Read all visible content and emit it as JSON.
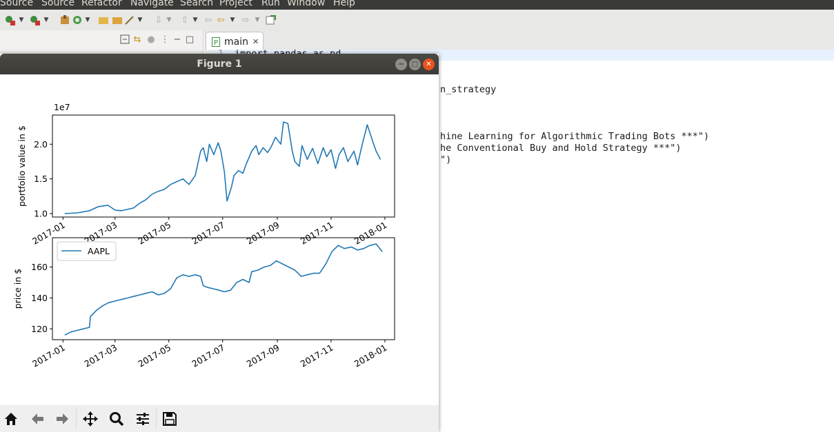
{
  "menubar": {
    "items": [
      "Source",
      "Source",
      "Refactor",
      "Navigate",
      "Search",
      "Project",
      "Run",
      "Window",
      "Help"
    ]
  },
  "editor": {
    "tab_label": "main",
    "tab_close": "✕",
    "line_number": "1",
    "code_lines": [
      "import pandas as pd",
      "n_strategy",
      "hine Learning for Algorithmic Trading Bots ***\")",
      "he Conventional Buy and Hold Strategy ***\")",
      "\")"
    ],
    "code_strings": [
      "hine Learning for Algorithmic Trading Bots ***",
      "he Conventional Buy and Hold Strategy ***"
    ]
  },
  "figure_window": {
    "title": "Figure 1",
    "controls": [
      "minimize",
      "maximize",
      "close"
    ],
    "toolbar_icons": [
      "home-icon",
      "back-arrow-icon",
      "forward-arrow-icon",
      "pan-icon",
      "zoom-icon",
      "subplots-icon",
      "save-icon"
    ]
  },
  "colors": {
    "line": "#1f77b4",
    "menubar_bg": "#3a3a38",
    "titlebar_bg": "#3c3b37",
    "close_button": "#e9541f",
    "string_green": "#2aa12a"
  },
  "chart_data": [
    {
      "type": "line",
      "ylabel": "portfolio value in $",
      "offset_text": "1e7",
      "yticks": [
        "1.0",
        "1.5",
        "2.0"
      ],
      "ytick_values": [
        1.0,
        1.5,
        2.0
      ],
      "xticks": [
        "2017-01",
        "2017-03",
        "2017-05",
        "2017-07",
        "2017-09",
        "2017-11",
        "2018-01"
      ],
      "ylim": [
        0.95,
        2.42
      ],
      "grid": false,
      "x": [
        "2017-01-03",
        "2017-01-17",
        "2017-01-31",
        "2017-02-10",
        "2017-02-21",
        "2017-03-01",
        "2017-03-08",
        "2017-03-15",
        "2017-03-22",
        "2017-03-29",
        "2017-04-05",
        "2017-04-12",
        "2017-04-19",
        "2017-04-26",
        "2017-05-03",
        "2017-05-10",
        "2017-05-17",
        "2017-05-24",
        "2017-05-31",
        "2017-06-06",
        "2017-06-09",
        "2017-06-13",
        "2017-06-16",
        "2017-06-21",
        "2017-06-26",
        "2017-06-29",
        "2017-07-03",
        "2017-07-06",
        "2017-07-11",
        "2017-07-14",
        "2017-07-19",
        "2017-07-24",
        "2017-07-28",
        "2017-08-03",
        "2017-08-08",
        "2017-08-11",
        "2017-08-16",
        "2017-08-21",
        "2017-08-25",
        "2017-08-30",
        "2017-09-05",
        "2017-09-08",
        "2017-09-13",
        "2017-09-18",
        "2017-09-21",
        "2017-09-26",
        "2017-09-29",
        "2017-10-05",
        "2017-10-11",
        "2017-10-17",
        "2017-10-23",
        "2017-10-27",
        "2017-11-01",
        "2017-11-06",
        "2017-11-10",
        "2017-11-15",
        "2017-11-20",
        "2017-11-27",
        "2017-12-01",
        "2017-12-06",
        "2017-12-12",
        "2017-12-18",
        "2017-12-22",
        "2017-12-27"
      ],
      "series": [
        {
          "values": [
            1.0,
            1.01,
            1.04,
            1.1,
            1.12,
            1.05,
            1.04,
            1.06,
            1.08,
            1.15,
            1.2,
            1.28,
            1.32,
            1.35,
            1.42,
            1.46,
            1.5,
            1.42,
            1.55,
            1.9,
            1.95,
            1.75,
            2.0,
            1.85,
            2.02,
            1.9,
            1.6,
            1.18,
            1.38,
            1.55,
            1.62,
            1.58,
            1.72,
            1.9,
            1.98,
            1.85,
            1.95,
            1.88,
            1.96,
            2.1,
            2.0,
            2.32,
            2.3,
            1.9,
            1.75,
            1.68,
            1.98,
            1.78,
            1.94,
            1.72,
            1.95,
            1.82,
            1.92,
            1.65,
            1.85,
            1.95,
            1.75,
            1.9,
            1.7,
            1.98,
            2.28,
            2.05,
            1.9,
            1.78
          ]
        }
      ]
    },
    {
      "type": "line",
      "ylabel": "price in $",
      "yticks": [
        "120",
        "140",
        "160"
      ],
      "ytick_values": [
        120,
        140,
        160
      ],
      "xticks": [
        "2017-01",
        "2017-03",
        "2017-05",
        "2017-07",
        "2017-09",
        "2017-11",
        "2018-01"
      ],
      "ylim": [
        113,
        179
      ],
      "grid": false,
      "legend": {
        "placement": "upper-left",
        "entries": [
          "AAPL"
        ]
      },
      "x": [
        "2017-01-03",
        "2017-01-10",
        "2017-01-17",
        "2017-01-24",
        "2017-01-31",
        "2017-02-01",
        "2017-02-08",
        "2017-02-15",
        "2017-02-22",
        "2017-03-01",
        "2017-03-08",
        "2017-03-15",
        "2017-03-22",
        "2017-03-29",
        "2017-04-05",
        "2017-04-12",
        "2017-04-19",
        "2017-04-26",
        "2017-05-03",
        "2017-05-10",
        "2017-05-17",
        "2017-05-24",
        "2017-05-31",
        "2017-06-06",
        "2017-06-09",
        "2017-06-13",
        "2017-06-20",
        "2017-06-27",
        "2017-07-03",
        "2017-07-10",
        "2017-07-17",
        "2017-07-24",
        "2017-07-31",
        "2017-08-03",
        "2017-08-10",
        "2017-08-17",
        "2017-08-24",
        "2017-08-31",
        "2017-09-07",
        "2017-09-14",
        "2017-09-21",
        "2017-09-28",
        "2017-10-05",
        "2017-10-12",
        "2017-10-19",
        "2017-10-26",
        "2017-11-02",
        "2017-11-09",
        "2017-11-16",
        "2017-11-24",
        "2017-12-01",
        "2017-12-08",
        "2017-12-15",
        "2017-12-22",
        "2017-12-29"
      ],
      "series": [
        {
          "name": "AAPL",
          "values": [
            116,
            118,
            119,
            120,
            121,
            128,
            132,
            135,
            137,
            138,
            139,
            140,
            141,
            142,
            143,
            144,
            142,
            143,
            146,
            153,
            155,
            154,
            155,
            154,
            148,
            147,
            146,
            145,
            144,
            145,
            150,
            152,
            150,
            157,
            158,
            160,
            161,
            164,
            162,
            160,
            158,
            154,
            155,
            156,
            156,
            162,
            170,
            174,
            172,
            173,
            171,
            172,
            174,
            175,
            170
          ]
        }
      ]
    }
  ]
}
